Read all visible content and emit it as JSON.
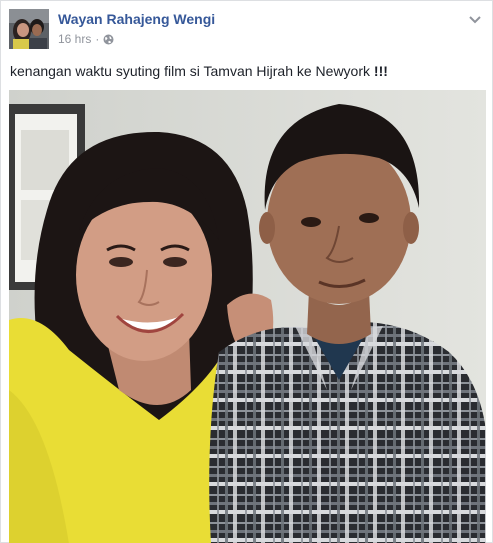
{
  "post": {
    "author_name": "Wayan Rahajeng Wengi",
    "timestamp": "16 hrs",
    "separator": "·",
    "privacy_icon": "globe-icon",
    "menu_icon": "chevron-down-icon",
    "caption_text": "kenangan waktu syuting film si Tamvan Hijrah ke Newyork ",
    "caption_emphasis": "!!!",
    "colors": {
      "author_link": "#365899",
      "meta_text": "#90949c",
      "body_text": "#1d2129",
      "shirt_yellow": "#e9dd35",
      "plaid_dark": "#2a2c31"
    }
  }
}
